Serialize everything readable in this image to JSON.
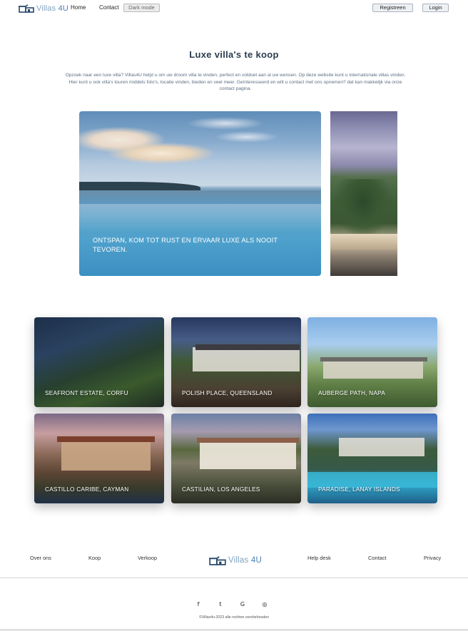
{
  "nav": {
    "logo_text": "Villas",
    "logo_suffix": "4U",
    "links": [
      "Home",
      "Contact"
    ],
    "dark_mode_label": "Dark mode",
    "register_label": "Registreen",
    "login_label": "Login"
  },
  "main": {
    "title": "Luxe villa's te koop",
    "intro": "Opzoek naar een luxe villa? Villas4U helpt u om uw droom villa te vinden, perfect en voldoet aan al uw wensen. Op deze website kunt u internationale villas vinden. Hier kunt u ook villa's touren middels foto's, locatie vinden, bieden en veel meer. Geïnteresseerd en wilt u contact met ons opnemen? dat kan makkelijk via onze contact pagina."
  },
  "hero": {
    "caption": "ONTSPAN, KOM TOT RUST EN ERVAAR LUXE ALS NOOIT TEVOREN."
  },
  "villas": [
    {
      "name": "SEAFRONT ESTATE, CORFU"
    },
    {
      "name": "POLISH PLACE, QUEENSLAND"
    },
    {
      "name": "AUBERGE PATH, NAPA"
    },
    {
      "name": "CASTILLO CARIBE, CAYMAN"
    },
    {
      "name": "CASTILIAN, LOS ANGELES"
    },
    {
      "name": "PARADISE, LANAY ISLANDS"
    }
  ],
  "footer": {
    "links_left": [
      "Over ons",
      "Koop",
      "Verkoop"
    ],
    "links_right": [
      "Help desk",
      "Contact",
      "Privacy"
    ],
    "social_icons": [
      "facebook-icon",
      "twitter-icon",
      "google-icon",
      "instagram-icon"
    ],
    "social_glyphs": [
      "f",
      "t",
      "G",
      "◎"
    ],
    "copyright": "©Villas4u-2023 alle rechten voorbehouden"
  },
  "colors": {
    "brand": "#7fa3c0",
    "brand_dark": "#2b3c4f",
    "title": "#2b3c4f"
  }
}
